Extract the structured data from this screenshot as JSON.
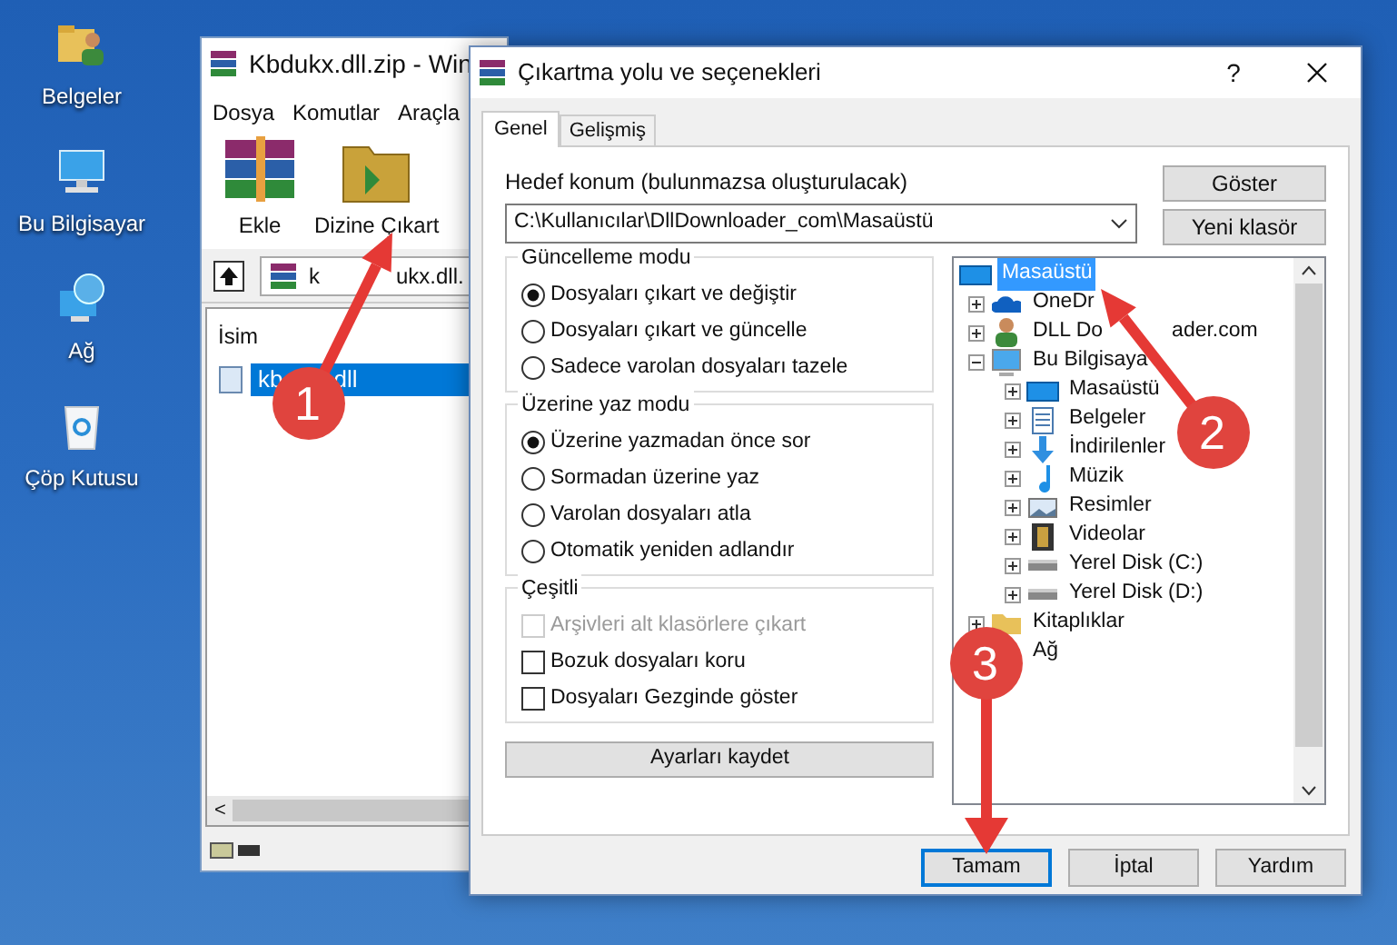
{
  "desktop_icons": [
    {
      "label": "Belgeler",
      "kind": "documents"
    },
    {
      "label": "Bu Bilgisayar",
      "kind": "computer"
    },
    {
      "label": "Ağ",
      "kind": "network"
    },
    {
      "label": "Çöp Kutusu",
      "kind": "recycle"
    }
  ],
  "winrar": {
    "title": "Kbdukx.dll.zip - Win",
    "menu": [
      "Dosya",
      "Komutlar",
      "Araçla"
    ],
    "toolbar": [
      {
        "label": "Ekle",
        "kind": "add"
      },
      {
        "label": "Dizine Çıkart",
        "kind": "extract"
      }
    ],
    "address_head": "k",
    "address_tail": "ukx.dll.",
    "column": "İsim",
    "files": [
      {
        "name_head": "kb",
        "name_tail": "dll",
        "selected": true
      }
    ],
    "scroll_left": "<"
  },
  "dialog": {
    "title": "Çıkartma yolu ve seçenekleri",
    "help": "?",
    "tabs": [
      {
        "label": "Genel",
        "selected": true
      },
      {
        "label": "Gelişmiş",
        "selected": false
      }
    ],
    "destination_label": "Hedef konum (bulunmazsa oluşturulacak)",
    "destination_value": "C:\\Kullanıcılar\\DllDownloader_com\\Masaüstü",
    "side_buttons": [
      "Göster",
      "Yeni klasör"
    ],
    "groups": [
      {
        "title": "Güncelleme modu",
        "kind": "radio",
        "options": [
          {
            "label": "Dosyaları çıkart ve değiştir",
            "selected": true
          },
          {
            "label": "Dosyaları çıkart ve güncelle",
            "selected": false
          },
          {
            "label": "Sadece varolan dosyaları tazele",
            "selected": false
          }
        ]
      },
      {
        "title": "Üzerine yaz modu",
        "kind": "radio",
        "options": [
          {
            "label": "Üzerine yazmadan önce sor",
            "selected": true
          },
          {
            "label": "Sormadan üzerine yaz",
            "selected": false
          },
          {
            "label": "Varolan dosyaları atla",
            "selected": false
          },
          {
            "label": "Otomatik yeniden adlandır",
            "selected": false
          }
        ]
      },
      {
        "title": "Çeşitli",
        "kind": "checkbox",
        "options": [
          {
            "label": "Arşivleri alt klasörlere çıkart",
            "checked": false,
            "disabled": true
          },
          {
            "label": "Bozuk dosyaları koru",
            "checked": false,
            "disabled": false
          },
          {
            "label": "Dosyaları Gezginde göster",
            "checked": false,
            "disabled": false
          }
        ]
      }
    ],
    "save_button": "Ayarları kaydet",
    "tree": [
      {
        "label": "Masaüstü",
        "kind": "desktop",
        "selected": true,
        "children": [
          {
            "label": "OneDr",
            "kind": "cloud",
            "selected": false,
            "expanded": false
          },
          {
            "label": "DLL Do",
            "label_tail": "ader.com",
            "kind": "user",
            "selected": false,
            "expanded": false
          },
          {
            "label": "Bu Bilgisaya",
            "kind": "computer",
            "selected": false,
            "expanded": true,
            "children": [
              {
                "label": "Masaüstü",
                "kind": "desktop",
                "selected": false,
                "expanded": false
              },
              {
                "label": "Belgeler",
                "kind": "document",
                "selected": false,
                "expanded": false
              },
              {
                "label": "İndirilenler",
                "kind": "download",
                "selected": false,
                "expanded": false
              },
              {
                "label": "Müzik",
                "kind": "music",
                "selected": false,
                "expanded": false
              },
              {
                "label": "Resimler",
                "kind": "picture",
                "selected": false,
                "expanded": false
              },
              {
                "label": "Videolar",
                "kind": "video",
                "selected": false,
                "expanded": false
              },
              {
                "label": "Yerel Disk (C:)",
                "kind": "drive",
                "selected": false,
                "expanded": false
              },
              {
                "label": "Yerel Disk (D:)",
                "kind": "drive",
                "selected": false,
                "expanded": false
              }
            ]
          },
          {
            "label": "Kitaplıklar",
            "kind": "folder",
            "selected": false,
            "expanded": false
          },
          {
            "label": "Ağ",
            "kind": "plain",
            "selected": false
          }
        ]
      }
    ],
    "buttons": [
      {
        "label": "Tamam",
        "default": true
      },
      {
        "label": "İptal",
        "default": false
      },
      {
        "label": "Yardım",
        "default": false
      }
    ]
  },
  "annotations": [
    {
      "number": "1"
    },
    {
      "number": "2"
    },
    {
      "number": "3"
    }
  ]
}
